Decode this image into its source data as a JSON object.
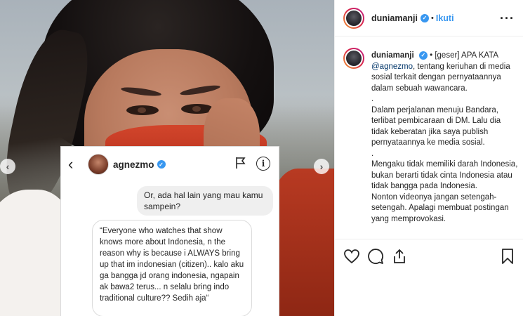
{
  "post": {
    "username": "duniamanji",
    "follow_label": "Ikuti",
    "dot": "•",
    "more_label": "···"
  },
  "dm": {
    "back_glyph": "‹",
    "username": "agnezmo",
    "info_glyph": "i",
    "message_out": "Or, ada hal lain yang mau kamu sampein?",
    "message_in": "“Everyone who watches that show knows more about Indonesia, n the reason why is because i ALWAYS bring up that im indonesian (citizen).. kalo aku ga bangga jd orang indonesia, ngapain ak bawa2 terus... n selalu bring indo traditional culture?? Sedih aja“"
  },
  "caption": {
    "username": "duniamanji",
    "intro": "• [geser] APA KATA",
    "mention": "@agnezmo",
    "intro_rest": ", tentang keriuhan di media sosial terkait dengan pernyataannya dalam sebuah wawancara.",
    "sep1": ".",
    "para1": "Dalam perjalanan menuju Bandara, terlibat pembicaraan di DM. Lalu dia tidak keberatan jika saya publish pernyataannya ke media sosial.",
    "sep2": ".",
    "para2": "Mengaku tidak memiliki darah Indonesia, bukan berarti tidak cinta Indonesia atau tidak bangga pada Indonesia.",
    "para3": "Nonton videonya jangan setengah-setengah. Apalagi membuat postingan yang memprovokasi."
  },
  "carousel": {
    "prev_glyph": "‹",
    "next_glyph": "›"
  },
  "icons": [
    "heart-icon",
    "comment-icon",
    "share-icon",
    "bookmark-icon",
    "flag-icon",
    "info-icon",
    "verified-icon"
  ],
  "colors": {
    "link": "#3897f0",
    "mention": "#003569",
    "verified": "#3897f0"
  }
}
